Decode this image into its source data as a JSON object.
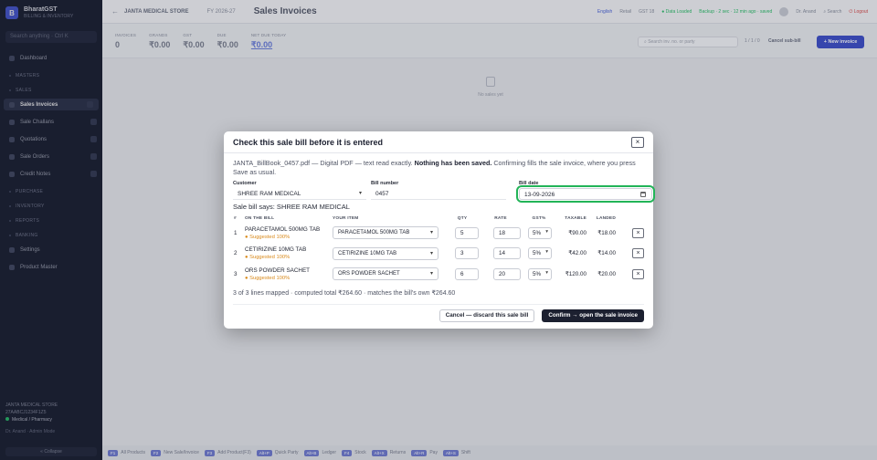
{
  "sidebar": {
    "brand_logo": "B",
    "brand_name": "BharatGST",
    "brand_sub": "BILLING & INVENTORY",
    "search_placeholder": "Search anything · Ctrl K",
    "items": [
      {
        "label": "Dashboard",
        "type": "item"
      },
      {
        "label": "MASTERS",
        "type": "section"
      },
      {
        "label": "SALES",
        "type": "section"
      },
      {
        "label": "Sales Invoices",
        "type": "active"
      },
      {
        "label": "Sale Challans",
        "type": "item"
      },
      {
        "label": "Quotations",
        "type": "item"
      },
      {
        "label": "Sale Orders",
        "type": "item"
      },
      {
        "label": "Credit Notes",
        "type": "item"
      },
      {
        "label": "PURCHASE",
        "type": "section"
      },
      {
        "label": "INVENTORY",
        "type": "section"
      },
      {
        "label": "REPORTS",
        "type": "section"
      },
      {
        "label": "BANKING",
        "type": "section"
      },
      {
        "label": "Settings",
        "type": "item"
      },
      {
        "label": "Product Master",
        "type": "item"
      }
    ],
    "foot_store": "JANTA MEDICAL STORE",
    "foot_gst": "27AABCJ1234F1Z5",
    "foot_plan": "Medical / Pharmacy",
    "user": "Dr. Anand · Admin Mode",
    "collapse": "« Collapse"
  },
  "topbar": {
    "back": "←",
    "store": "JANTA MEDICAL STORE",
    "fy": "FY 2026-27",
    "title": "Sales Invoices",
    "lang": "English",
    "mode": "Retail",
    "gst": "GST 18",
    "status": "● Data Loaded",
    "backup": "Backup · 2 sec · 12 min ago · saved",
    "user": "Dr. Anand",
    "search": "⌕ Search",
    "logout": "⏻ Logout"
  },
  "stats": [
    {
      "label": "INVOICES",
      "value": "0",
      "link": false
    },
    {
      "label": "GRANDS",
      "value": "₹0.00",
      "link": false
    },
    {
      "label": "GST",
      "value": "₹0.00",
      "link": false
    },
    {
      "label": "DUE",
      "value": "₹0.00",
      "link": false
    },
    {
      "label": "NET DUE TODAY",
      "value": "₹0.00",
      "link": true
    }
  ],
  "main": {
    "search_placeholder": "⌕ Search inv. no. or party",
    "range": "1 / 1 / 0",
    "cancel_sub": "Cancel sub-bill",
    "new_invoice": "+ New invoice",
    "empty": "No sales yet"
  },
  "shortcuts": [
    {
      "key": "F1",
      "label": "All Products"
    },
    {
      "key": "F2",
      "label": "New Sale/Invoice"
    },
    {
      "key": "F3",
      "label": "Add Product(F3)"
    },
    {
      "key": "Alt+P",
      "label": "Quick Party"
    },
    {
      "key": "Alt+B",
      "label": "Ledger"
    },
    {
      "key": "F4",
      "label": "Stock"
    },
    {
      "key": "Alt+X",
      "label": "Returns"
    },
    {
      "key": "Alt+R",
      "label": "Pay"
    },
    {
      "key": "Alt+S",
      "label": "Shift"
    }
  ],
  "modal": {
    "title": "Check this sale bill before it is entered",
    "close": "×",
    "intro_file": "JANTA_BillBook_0457.pdf — Digital PDF — text read exactly.",
    "intro_bold": "Nothing has been saved.",
    "intro_rest": "Confirming fills the sale invoice, where you press Save as usual.",
    "customer_label": "Customer",
    "customer_value": "SHREE RAM MEDICAL",
    "bill_number_label": "Bill number",
    "bill_number_value": "0457",
    "bill_date_label": "Bill date",
    "bill_date_value": "13-09-2026",
    "says": "Sale bill says: SHREE RAM MEDICAL",
    "columns": {
      "no": "#",
      "bill": "ON THE BILL",
      "item": "YOUR ITEM",
      "qty": "QTY",
      "rate": "RATE",
      "gst": "GST%",
      "taxable": "TAXABLE",
      "landed": "LANDED"
    },
    "lines": [
      {
        "no": "1",
        "bill": "PARACETAMOL 500MG TAB",
        "suggest": "● Suggested 100%",
        "item": "PARACETAMOL 500MG TAB",
        "qty": "5",
        "rate": "18",
        "gst": "5%",
        "taxable": "₹90.00",
        "landed": "₹18.00"
      },
      {
        "no": "2",
        "bill": "CETIRIZINE 10MG TAB",
        "suggest": "● Suggested 100%",
        "item": "CETIRIZINE 10MG TAB",
        "qty": "3",
        "rate": "14",
        "gst": "5%",
        "taxable": "₹42.00",
        "landed": "₹14.00"
      },
      {
        "no": "3",
        "bill": "ORS POWDER SACHET",
        "suggest": "● Suggested 100%",
        "item": "ORS POWDER SACHET",
        "qty": "6",
        "rate": "20",
        "gst": "5%",
        "taxable": "₹120.00",
        "landed": "₹20.00"
      }
    ],
    "summary": "3 of 3 lines mapped · computed total ₹264.60 · matches the bill's own ₹264.60",
    "cancel": "Cancel — discard this sale bill",
    "confirm": "Confirm → open the sale invoice"
  }
}
